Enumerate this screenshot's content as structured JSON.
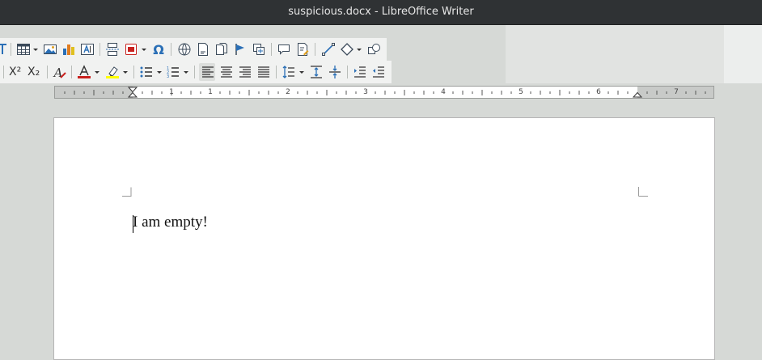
{
  "window": {
    "title": "suspicious.docx - LibreOffice Writer"
  },
  "toolbar1": {
    "items": [
      "format-icon",
      "insert-table-button",
      "insert-image-button",
      "insert-chart-button",
      "insert-textbox-button",
      "page-break-button",
      "insert-field-button",
      "special-character-button",
      "hyperlink-button",
      "footnote-button",
      "endnote-button",
      "bookmark-button",
      "cross-reference-button",
      "comment-button",
      "track-changes-button",
      "line-button",
      "basic-shapes-button",
      "draw-functions-button"
    ]
  },
  "toolbar2": {
    "superscript_label": "X²",
    "subscript_label": "X₂",
    "colors": {
      "font_color": "#c9211e",
      "highlight": "#ffff00"
    }
  },
  "ruler": {
    "numbers": [
      "1",
      "1",
      "2",
      "3",
      "4",
      "5",
      "6",
      "7"
    ]
  },
  "document": {
    "text": "I am empty!"
  }
}
